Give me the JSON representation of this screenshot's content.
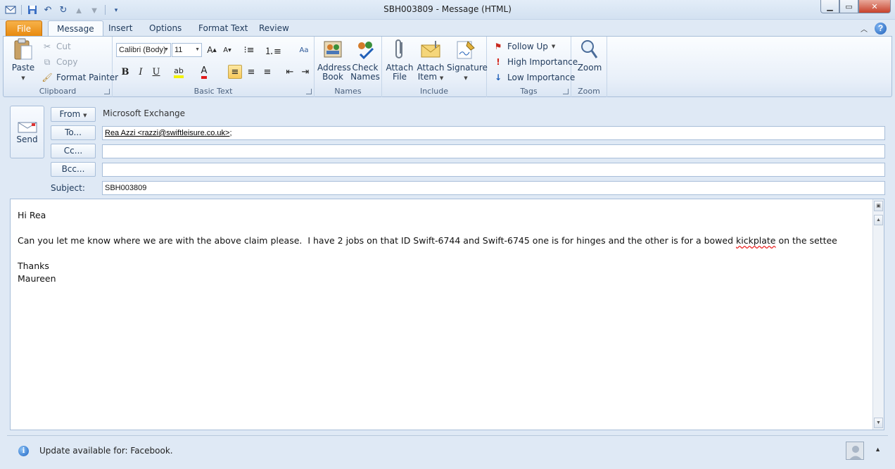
{
  "window": {
    "title": "SBH003809  -  Message (HTML)"
  },
  "qat": {
    "icons": [
      "outlook-icon",
      "save-icon",
      "undo-icon",
      "redo-icon",
      "previous-icon",
      "next-icon",
      "customize-icon"
    ]
  },
  "tabs": [
    {
      "label": "File"
    },
    {
      "label": "Message"
    },
    {
      "label": "Insert"
    },
    {
      "label": "Options"
    },
    {
      "label": "Format Text"
    },
    {
      "label": "Review"
    }
  ],
  "ribbon": {
    "clipboard": {
      "label": "Clipboard",
      "paste": "Paste",
      "cut": "Cut",
      "copy": "Copy",
      "format_painter": "Format Painter"
    },
    "basic_text": {
      "label": "Basic Text",
      "font": "Calibri (Body)",
      "size": "11"
    },
    "names": {
      "label": "Names",
      "address_book_1": "Address",
      "address_book_2": "Book",
      "check_names_1": "Check",
      "check_names_2": "Names"
    },
    "include": {
      "label": "Include",
      "attach_file_1": "Attach",
      "attach_file_2": "File",
      "attach_item_1": "Attach",
      "attach_item_2": "Item",
      "signature": "Signature"
    },
    "tags": {
      "label": "Tags",
      "follow_up": "Follow Up",
      "high_importance": "High Importance",
      "low_importance": "Low Importance"
    },
    "zoom": {
      "label": "Zoom",
      "zoom_btn": "Zoom"
    }
  },
  "compose": {
    "send": "Send",
    "from_btn": "From",
    "from_value": "Microsoft Exchange",
    "to_btn": "To...",
    "to_value": "Rea Azzi <razzi@swiftleisure.co.uk>",
    "to_suffix": ";",
    "cc_btn": "Cc...",
    "cc_value": "",
    "bcc_btn": "Bcc...",
    "bcc_value": "",
    "subject_label": "Subject:",
    "subject_value": "SBH003809"
  },
  "body": {
    "line1": "Hi Rea",
    "line2_before": "Can you let me know where we are with the above claim please.  I have 2 jobs on that ID Swift-6744 and Swift-6745 one is for hinges and the other is for a bowed ",
    "line2_misspelled": "kickplate",
    "line2_after": " on the settee",
    "line3": "Thanks",
    "line4": "Maureen"
  },
  "status": {
    "message": "Update available for: Facebook."
  },
  "colors": {
    "file_tab": "#e88a0f",
    "ribbon_border": "#a8bed9",
    "close_button": "#c7412b"
  }
}
